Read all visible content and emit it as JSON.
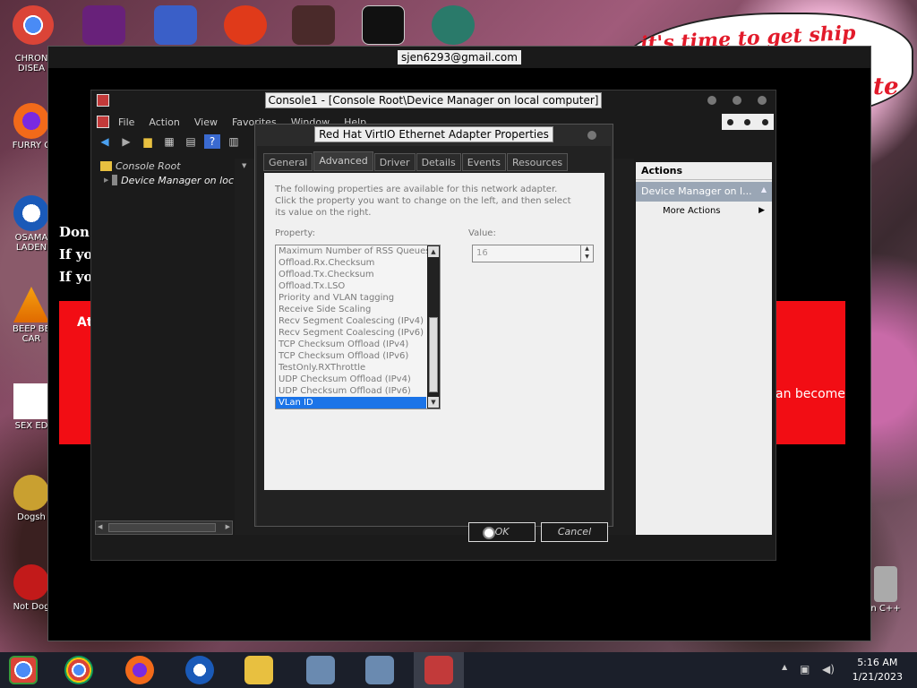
{
  "desktop": {
    "bubble_text": "it's time to get ship",
    "partial_right_text": "te",
    "icons": [
      {
        "label": "CHRON\nDISEA"
      },
      {
        "label": "FURRY C"
      },
      {
        "label": "OSAMA\nLADEN"
      },
      {
        "label": "BEEP BE\nCAR"
      },
      {
        "label": "SEX ED"
      },
      {
        "label": "Dogsh"
      },
      {
        "label": "Not Dog"
      }
    ],
    "right_icon_label": "n C++"
  },
  "remote": {
    "title": "sjen6293@gmail.com",
    "page_lines": [
      "Don'",
      "If yo",
      "If yo"
    ],
    "red_box_text": "At",
    "red_box_right_text": "an become"
  },
  "mmc": {
    "title": "Console1 - [Console Root\\Device Manager on local computer]",
    "menu": [
      "File",
      "Action",
      "View",
      "Favorites",
      "Window",
      "Help"
    ],
    "tree": {
      "root": "Console Root",
      "child": "Device Manager on loc"
    },
    "actions": {
      "header": "Actions",
      "section": "Device Manager on l...",
      "item": "More Actions"
    }
  },
  "dialog": {
    "title": "Red Hat VirtIO Ethernet Adapter Properties",
    "tabs": [
      "General",
      "Advanced",
      "Driver",
      "Details",
      "Events",
      "Resources"
    ],
    "active_tab": "Advanced",
    "description": "The following properties are available for this network adapter. Click the property you want to change on the left, and then select its value on the right.",
    "property_label": "Property:",
    "value_label": "Value:",
    "properties": [
      "Maximum Number of RSS Queues",
      "Offload.Rx.Checksum",
      "Offload.Tx.Checksum",
      "Offload.Tx.LSO",
      "Priority and VLAN tagging",
      "Receive Side Scaling",
      "Recv Segment Coalescing (IPv4)",
      "Recv Segment Coalescing (IPv6)",
      "TCP Checksum Offload (IPv4)",
      "TCP Checksum Offload (IPv6)",
      "TestOnly.RXThrottle",
      "UDP Checksum Offload (IPv4)",
      "UDP Checksum Offload (IPv6)",
      "VLan ID"
    ],
    "selected_property": "VLan ID",
    "value": "16",
    "ok_label": "OK",
    "cancel_label": "Cancel"
  },
  "taskbar": {
    "time": "5:16 AM",
    "date": "1/21/2023"
  }
}
